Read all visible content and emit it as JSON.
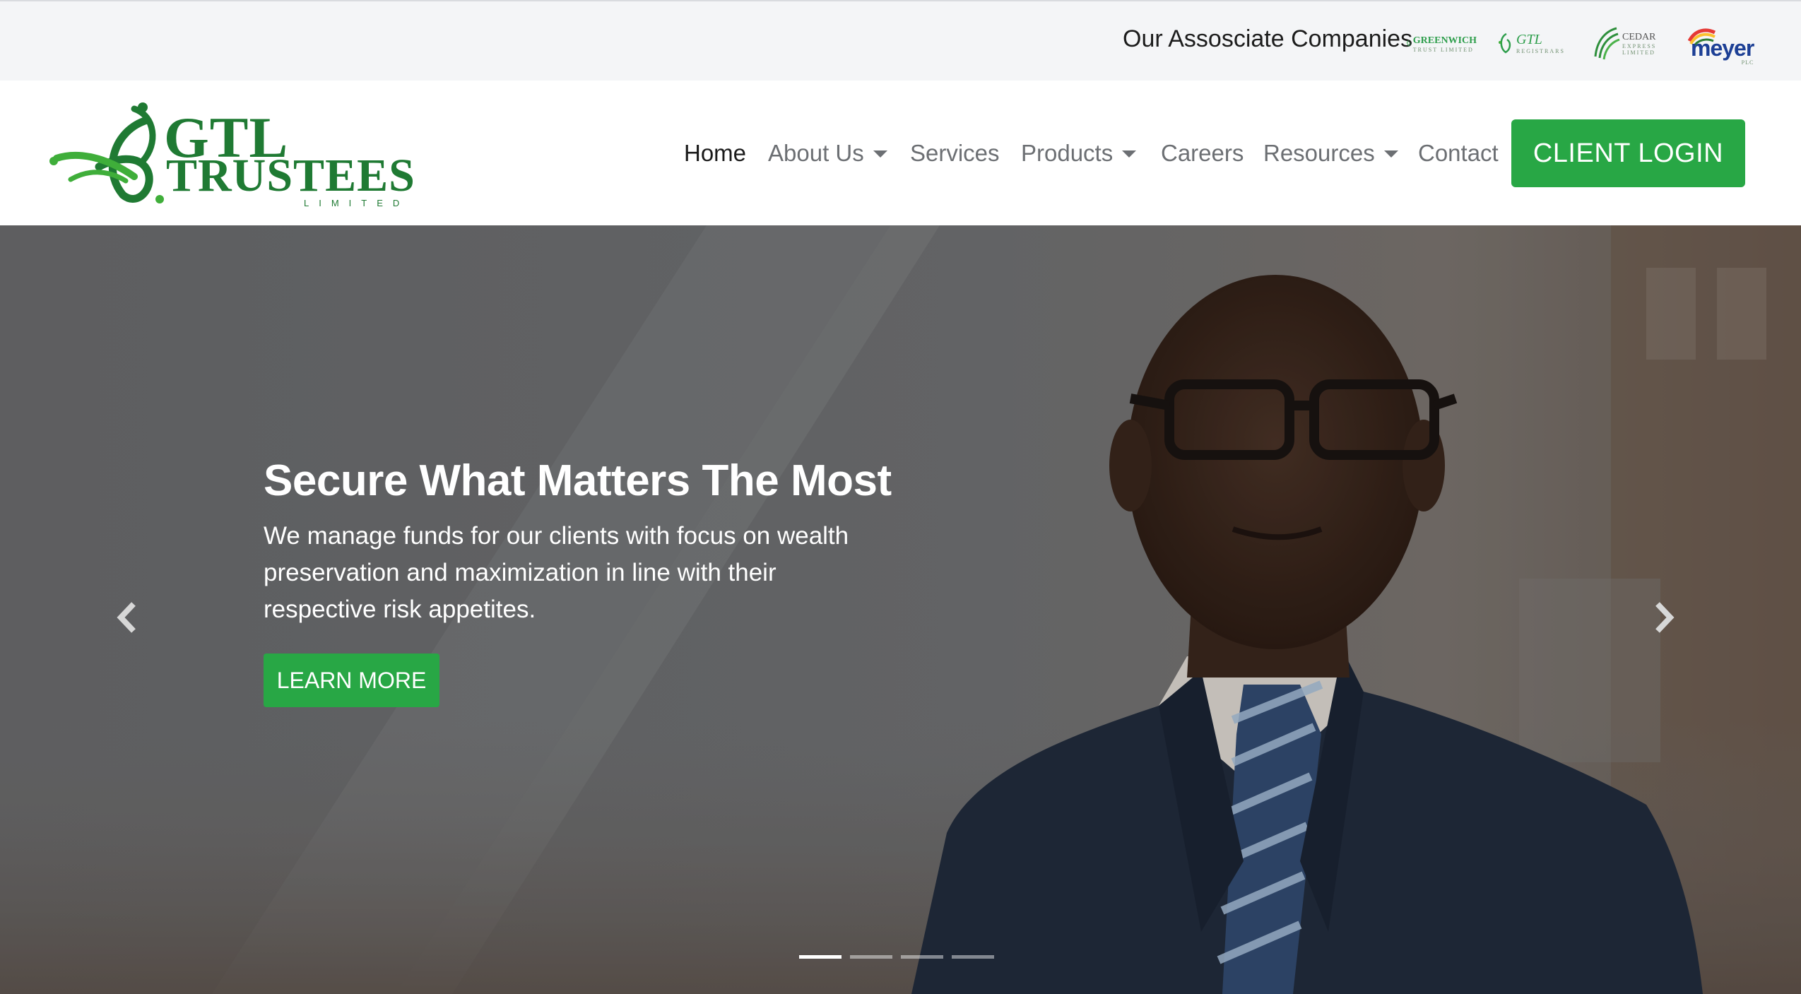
{
  "associates": {
    "title": "Our Assosciate Companies",
    "logos": [
      {
        "name": "GREENWICH",
        "sub": "TRUST LIMITED",
        "color": "#2e9e4c"
      },
      {
        "name": "GTL",
        "sub": "REGISTRARS",
        "color": "#2e9e4c"
      },
      {
        "name": "CEDAR",
        "sub": "EXPRESS LIMITED",
        "color": "#2e8f3c"
      },
      {
        "name": "meyer",
        "sub": "PLC",
        "color": "#1c3f95"
      }
    ]
  },
  "brand": {
    "line1": "GTL",
    "line2": "TRUSTEES",
    "line3": "LIMITED",
    "color": "#1f7a33",
    "accent": "#3fae3a"
  },
  "nav": {
    "items": [
      {
        "label": "Home",
        "active": true,
        "dropdown": false
      },
      {
        "label": "About Us",
        "active": false,
        "dropdown": true
      },
      {
        "label": "Services",
        "active": false,
        "dropdown": false
      },
      {
        "label": "Products",
        "active": false,
        "dropdown": true
      },
      {
        "label": "Careers",
        "active": false,
        "dropdown": false
      },
      {
        "label": "Resources",
        "active": false,
        "dropdown": true
      },
      {
        "label": "Contact",
        "active": false,
        "dropdown": false
      }
    ],
    "login_label": "CLIENT LOGIN"
  },
  "hero": {
    "title": "Secure What Matters The Most",
    "text": "We manage funds for our clients with focus on wealth preservation and maximization in line with their respective risk appetites.",
    "button_label": "LEARN MORE",
    "slides": 4,
    "active_slide": 1
  },
  "colors": {
    "primary_green": "#28a745",
    "nav_text": "#6c6f73",
    "assoc_bar_bg": "#f4f5f7"
  },
  "icons": {
    "prev": "chevron-left-icon",
    "next": "chevron-right-icon"
  }
}
